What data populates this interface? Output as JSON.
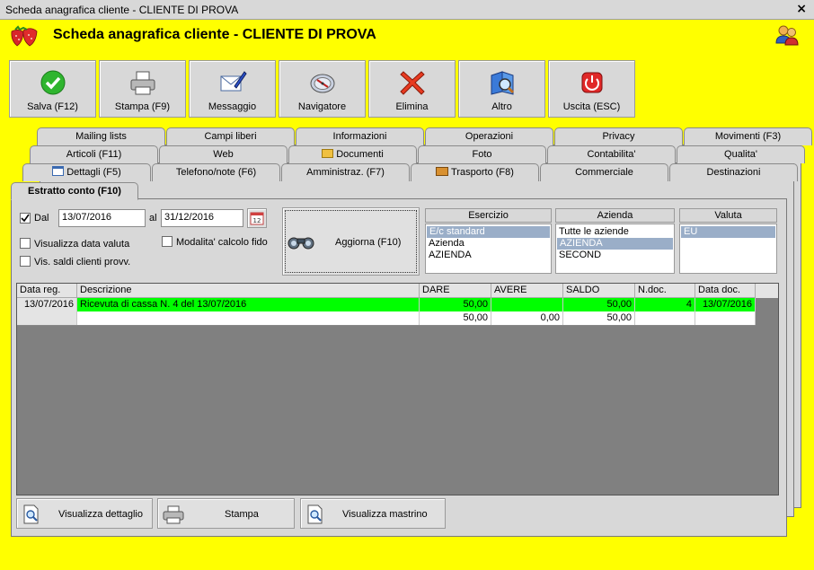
{
  "window": {
    "title": "Scheda anagrafica cliente - CLIENTE DI PROVA",
    "close": "×"
  },
  "header": {
    "title": "Scheda anagrafica cliente - CLIENTE DI PROVA"
  },
  "toolbar": [
    {
      "label": "Salva (F12)",
      "icon": "check-icon"
    },
    {
      "label": "Stampa (F9)",
      "icon": "printer-icon"
    },
    {
      "label": "Messaggio",
      "icon": "message-icon"
    },
    {
      "label": "Navigatore",
      "icon": "compass-icon"
    },
    {
      "label": "Elimina",
      "icon": "delete-icon"
    },
    {
      "label": "Altro",
      "icon": "book-search-icon"
    },
    {
      "label": "Uscita (ESC)",
      "icon": "exit-icon"
    }
  ],
  "tabs": {
    "row1": [
      "Mailing lists",
      "Campi liberi",
      "Informazioni",
      "Operazioni",
      "Privacy",
      "Movimenti (F3)"
    ],
    "row2": [
      "Articoli (F11)",
      "Web",
      "Documenti",
      "Foto",
      "Contabilita'",
      "Qualita'"
    ],
    "row3": [
      "Dettagli (F5)",
      "Telefono/note (F6)",
      "Amministraz. (F7)",
      "Trasporto (F8)",
      "Commerciale",
      "Destinazioni"
    ],
    "active": "Estratto conto (F10)"
  },
  "filters": {
    "dal_label": "Dal",
    "dal_checked": true,
    "dal_value": "13/07/2016",
    "al_label": "al",
    "al_value": "31/12/2016",
    "visualizza_data_valuta": "Visualizza data valuta",
    "vis_saldi": "Vis. saldi clienti provv.",
    "modalita": "Modalita' calcolo fido",
    "aggiorna": "Aggiorna (F10)"
  },
  "lists": {
    "esercizio": {
      "header": "Esercizio",
      "items": [
        "E/c standard",
        "Azienda",
        "AZIENDA"
      ],
      "selected": 0
    },
    "azienda": {
      "header": "Azienda",
      "items": [
        "Tutte le aziende",
        "AZIENDA",
        "SECOND"
      ],
      "selected": 1
    },
    "valuta": {
      "header": "Valuta",
      "items": [
        "EU"
      ],
      "selected": 0
    }
  },
  "grid": {
    "columns": [
      "Data reg.",
      "Descrizione",
      "DARE",
      "AVERE",
      "SALDO",
      "N.doc.",
      "Data doc."
    ],
    "rows": [
      {
        "data_reg": "13/07/2016",
        "descrizione": "Ricevuta di cassa N. 4 del 13/07/2016",
        "dare": "50,00",
        "avere": "",
        "saldo": "50,00",
        "ndoc": "4",
        "data_doc": "13/07/2016"
      }
    ],
    "totals": {
      "dare": "50,00",
      "avere": "0,00",
      "saldo": "50,00"
    }
  },
  "bottom_buttons": [
    "Visualizza dettaglio",
    "Stampa",
    "Visualizza mastrino"
  ],
  "colors": {
    "background": "#ffff00",
    "highlight_row": "#00ff00",
    "selection": "#9aaec8",
    "grid_empty": "#808080"
  }
}
